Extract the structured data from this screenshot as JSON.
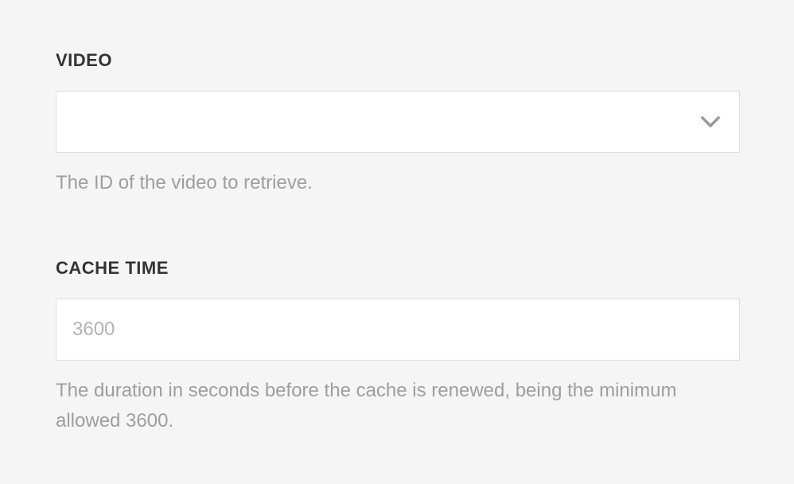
{
  "video_field": {
    "label": "VIDEO",
    "selected_value": "",
    "icon": "chevron-down-icon",
    "help": "The ID of the video to retrieve."
  },
  "cache_time_field": {
    "label": "CACHE TIME",
    "value": "",
    "placeholder": "3600",
    "help": "The duration in seconds before the cache is renewed, being the minimum allowed 3600."
  },
  "colors": {
    "background": "#f5f5f5",
    "label": "#333333",
    "help_text": "#9e9e9e",
    "input_border": "#dcdcdc",
    "placeholder": "#b3b3b3",
    "chevron": "#9a9a9a"
  }
}
